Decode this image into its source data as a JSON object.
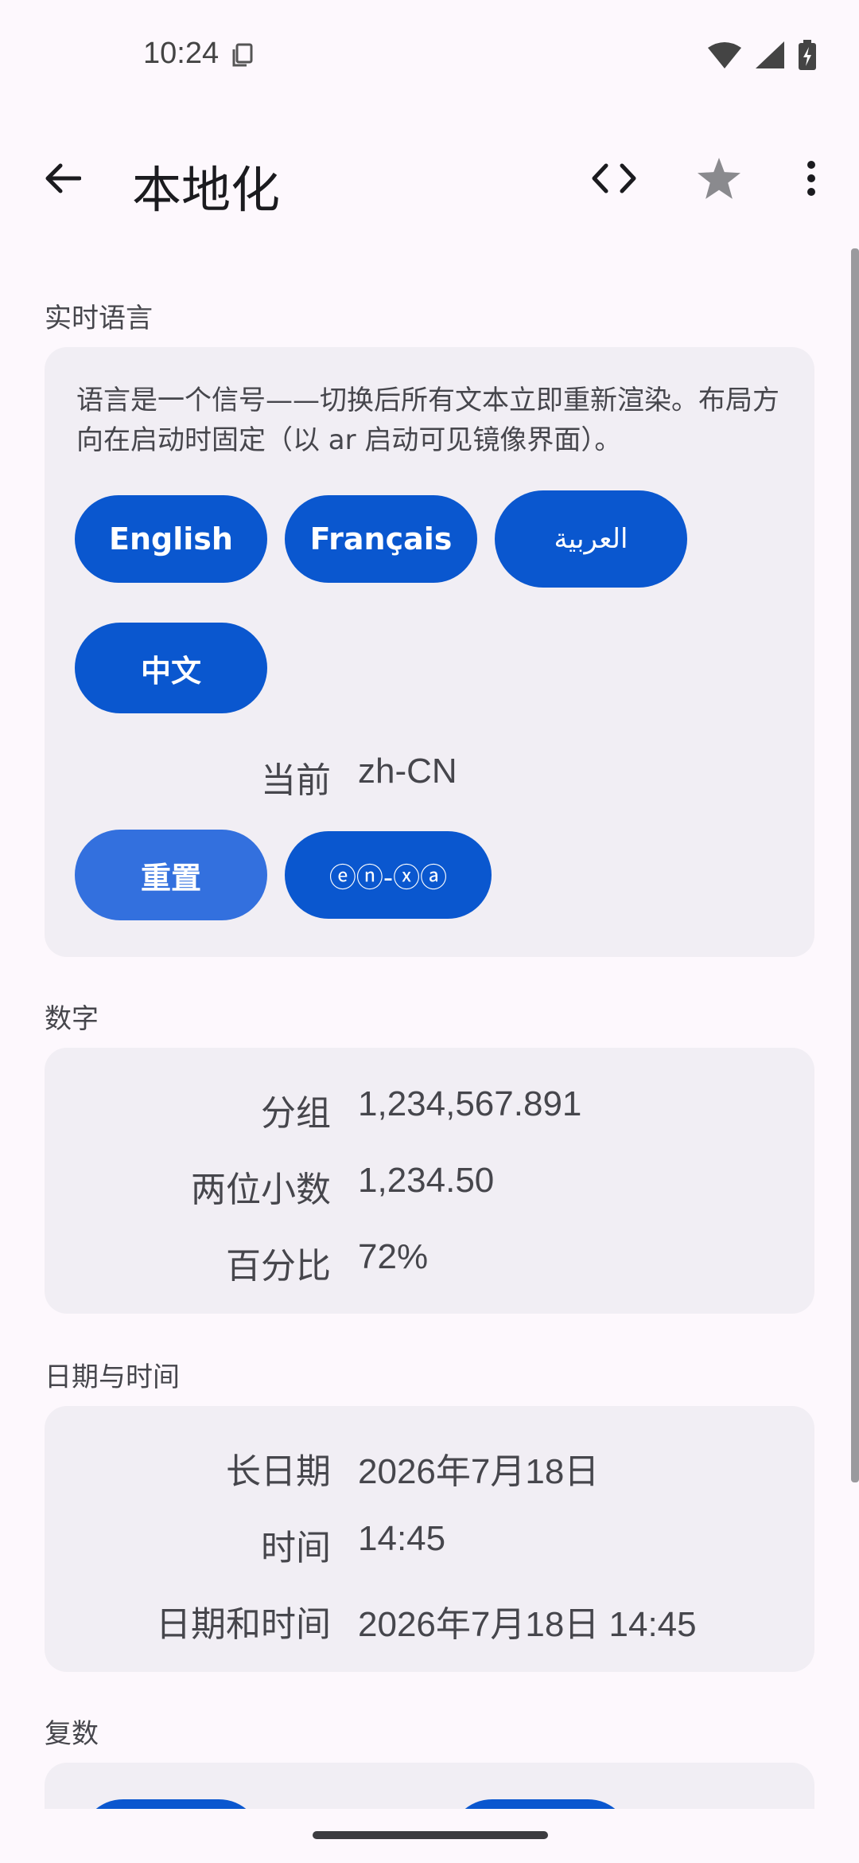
{
  "status": {
    "time": "10:24"
  },
  "app_bar": {
    "title": "本地化"
  },
  "sections": {
    "language": {
      "title": "实时语言",
      "description": "语言是一个信号——切换后所有文本立即重新渲染。布局方向在启动时固定（以 ar 启动可见镜像界面）。",
      "buttons": [
        "English",
        "Français",
        "العربية",
        "中文"
      ],
      "current_label": "当前",
      "current_value": "zh-CN",
      "reset_label": "重置",
      "pseudo_label": "ⓔⓝ-ⓧⓐ"
    },
    "numbers": {
      "title": "数字",
      "rows": [
        {
          "label": "分组",
          "value": "1,234,567.891"
        },
        {
          "label": "两位小数",
          "value": "1,234.50"
        },
        {
          "label": "百分比",
          "value": "72%"
        }
      ]
    },
    "datetime": {
      "title": "日期与时间",
      "rows": [
        {
          "label": "长日期",
          "value": "2026年7月18日"
        },
        {
          "label": "时间",
          "value": "14:45"
        },
        {
          "label": "日期和时间",
          "value": "2026年7月18日 14:45"
        }
      ]
    },
    "plurals": {
      "title": "复数"
    }
  },
  "colors": {
    "primary": "#0a57cf",
    "primary_light": "#3370de",
    "card_bg": "#f1eef4",
    "page_bg": "#fdf8fd"
  },
  "icons": {
    "back": "arrow-left-icon",
    "code": "code-icon",
    "star": "star-icon",
    "more": "more-vertical-icon",
    "wifi": "wifi-icon",
    "signal": "signal-icon",
    "battery": "battery-charging-icon"
  }
}
